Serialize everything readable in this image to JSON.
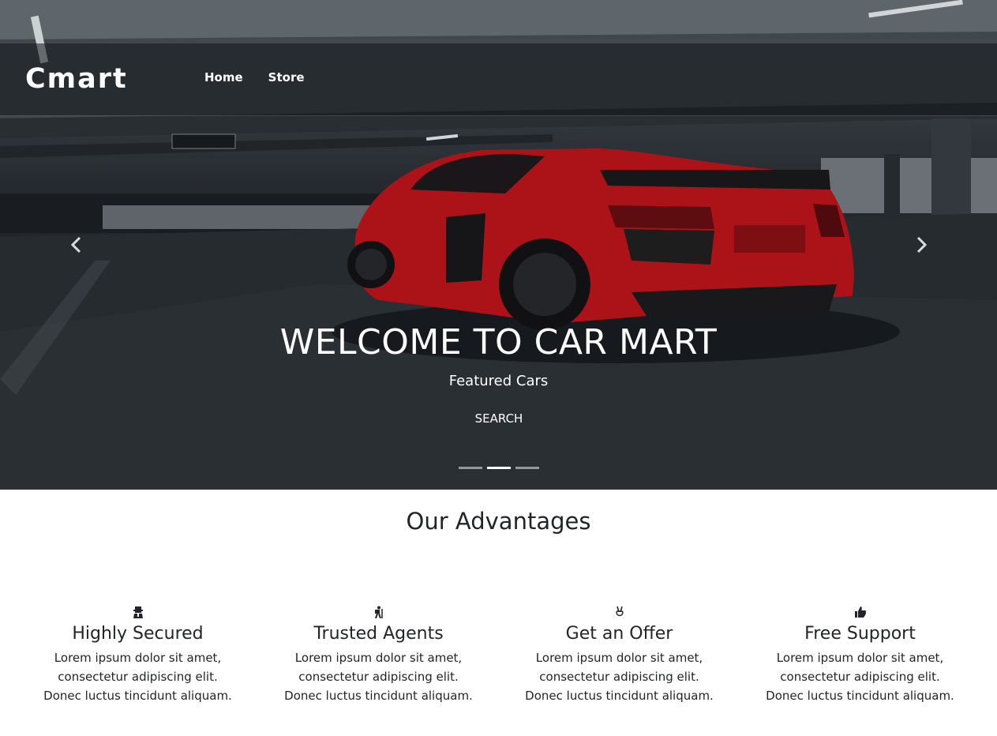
{
  "brand": {
    "name": "Cmart"
  },
  "nav": {
    "items": [
      "Home",
      "Store"
    ]
  },
  "hero": {
    "title": "WELCOME TO CAR MART",
    "subtitle": "Featured Cars",
    "button_label": "SEARCH",
    "slides": 3,
    "active_slide": 2,
    "car_color": "#c4161c"
  },
  "advantages": {
    "title": "Our Advantages",
    "items": [
      {
        "icon": "user-secret-icon",
        "title": "Highly Secured",
        "text": "Lorem ipsum dolor sit amet, consectetur adipiscing elit. Donec luctus tincidunt aliquam."
      },
      {
        "icon": "hiking-icon",
        "title": "Trusted Agents",
        "text": "Lorem ipsum dolor sit amet, consectetur adipiscing elit. Donec luctus tincidunt aliquam."
      },
      {
        "icon": "victory-hand-icon",
        "title": "Get an Offer",
        "text": "Lorem ipsum dolor sit amet, consectetur adipiscing elit. Donec luctus tincidunt aliquam."
      },
      {
        "icon": "thumbs-up-icon",
        "title": "Free Support",
        "text": "Lorem ipsum dolor sit amet, consectetur adipiscing elit. Donec luctus tincidunt aliquam."
      }
    ]
  }
}
